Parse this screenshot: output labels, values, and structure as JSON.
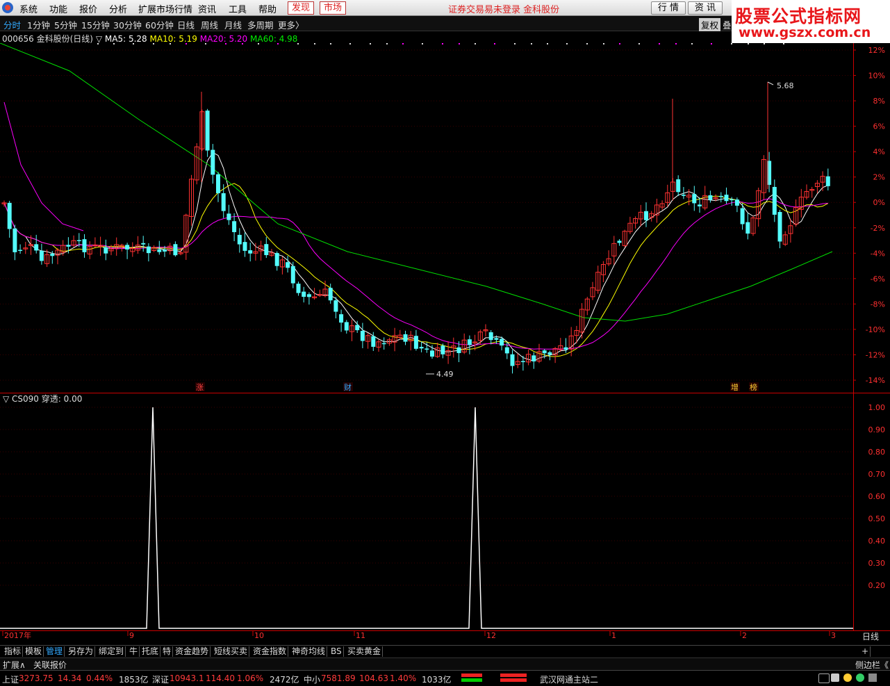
{
  "menu": {
    "items": [
      "系统",
      "功能",
      "报价",
      "分析",
      "扩展市场行情",
      "资讯",
      "工具",
      "帮助"
    ],
    "discover": "发现",
    "market": "市场",
    "login_status": "证券交易易未登录  金科股份",
    "btn_quote": "行 情",
    "btn_news": "资 讯"
  },
  "watermark": {
    "name": "股票公式指标网",
    "url": "www.gszx.com.cn"
  },
  "periods": {
    "items": [
      "分时",
      "1分钟",
      "5分钟",
      "15分钟",
      "30分钟",
      "60分钟",
      "日线",
      "周线",
      "月线",
      "多周期",
      "更多〉"
    ],
    "restore": "复权",
    "overlay": "叠"
  },
  "info": {
    "stock": "000656 金科股份(日线)",
    "ma5": "MA5: 5.28",
    "ma10": "MA10: 5.19",
    "ma20": "MA20: 5.20",
    "ma60": "MA60: 4.98"
  },
  "indicator": {
    "name": "CS090",
    "value_label": "穿透: 0.00"
  },
  "colors": {
    "up": "#ff3232",
    "down": "#54fcfc",
    "ma5": "#ffffff",
    "ma10": "#ffff00",
    "ma20": "#ff00ff",
    "ma60": "#00e000"
  },
  "chart_data": {
    "type": "candlestick",
    "price_axis_percent": [
      "12%",
      "10%",
      "8%",
      "6%",
      "4%",
      "2%",
      "0%",
      "-2%",
      "-4%",
      "-6%",
      "-8%",
      "-10%",
      "-12%",
      "-14%"
    ],
    "indicator_axis": [
      "1.00",
      "0.90",
      "0.80",
      "0.70",
      "0.60",
      "0.50",
      "0.40",
      "0.30",
      "0.20"
    ],
    "max_label": "5.68",
    "min_label": "4.49",
    "event_markers": [
      "涨",
      "财",
      "增",
      "榜"
    ],
    "time_axis": [
      "2017年",
      "9",
      "10",
      "11",
      "12",
      "1",
      "2",
      "3"
    ],
    "period_label": "日线",
    "indicator_spikes": [
      1.0,
      1.0
    ]
  },
  "tabs": [
    "指标",
    "模板",
    "管理",
    "另存为",
    "绑定到",
    "牛",
    "托底",
    "特",
    "资金趋势",
    "短线买卖",
    "资金指数",
    "神奇均线",
    "BS",
    "买卖黄金"
  ],
  "ext": {
    "left": "扩展∧",
    "related": "关联报价",
    "sidebar": "侧边栏《"
  },
  "status": {
    "sh_label": "上证",
    "sh_val": "3273.75",
    "sh_chg": "14.34",
    "sh_pct": "0.44%",
    "sh_amt": "1853亿",
    "sz_label": "深证",
    "sz_val": "10943.1",
    "sz_chg": "114.40",
    "sz_pct": "1.06%",
    "sz_amt": "2472亿",
    "zx_label": "中小",
    "zx_val": "7581.89",
    "zx_chg": "104.63",
    "zx_pct": "1.40%",
    "zx_amt": "1033亿",
    "server": "武汉网通主站二"
  }
}
